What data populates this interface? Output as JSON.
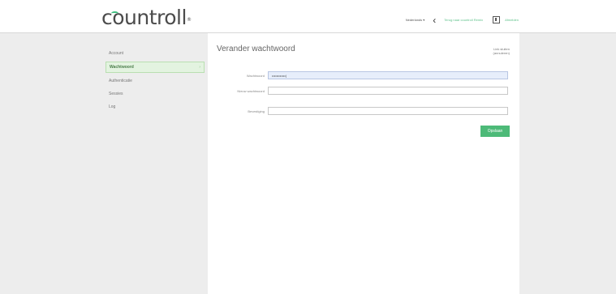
{
  "header": {
    "logo_text": "countroll",
    "logo_mark": "®",
    "language": "Nederlands ▾",
    "back_icon": "chevron-left-icon",
    "primary_link": "Terug naar countroll Remix",
    "logout_icon": "logout-icon",
    "logout_label": "Afmelden"
  },
  "sidebar": {
    "items": [
      {
        "label": "Account"
      },
      {
        "label": "Wachtwoord",
        "active": true
      },
      {
        "label": "Authenticatie"
      },
      {
        "label": "Sessies"
      },
      {
        "label": "Log"
      }
    ],
    "active_chevron": "›"
  },
  "main": {
    "title": "Verander wachtwoord",
    "cancel_link": "Link sluiten (annuleren)",
    "fields": [
      {
        "label": "Wachtwoord",
        "value": "••••••••••••|",
        "placeholder": ""
      },
      {
        "label": "Nieuw wachtwoord",
        "value": "",
        "placeholder": ""
      },
      {
        "label": "Bevestiging",
        "value": "",
        "placeholder": ""
      }
    ],
    "save_label": "Opslaan"
  },
  "colors": {
    "accent": "#4dba78",
    "active_bg": "#e3f3e0",
    "focused_input_bg": "#e7eefb",
    "page_bg": "#ededed"
  }
}
